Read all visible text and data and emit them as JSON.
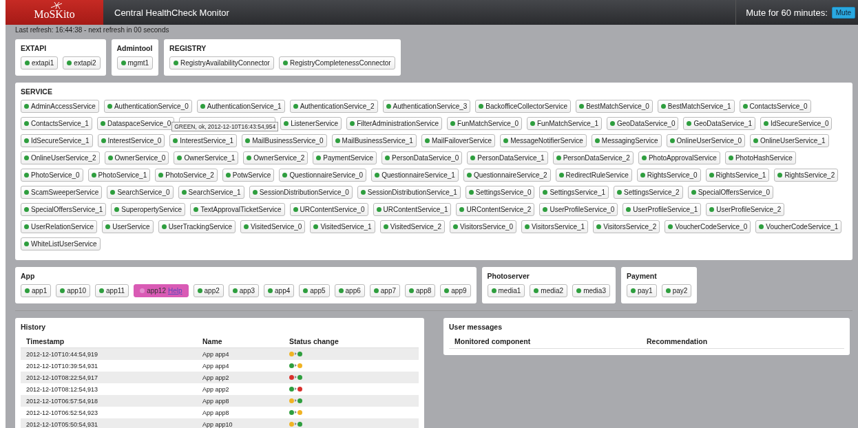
{
  "header": {
    "logo": "MoSKito",
    "title": "Central HealthCheck Monitor",
    "mute_label": "Mute for 60 minutes:",
    "mute_button": "Mute"
  },
  "refresh": "Last refresh: 16:44:38 - next refresh in 00 seconds",
  "top_groups": [
    {
      "title": "EXTAPI",
      "components": [
        {
          "label": "extapi1",
          "color": "#2e9e3e"
        },
        {
          "label": "extapi2",
          "color": "#2e9e3e"
        }
      ]
    },
    {
      "title": "Admintool",
      "components": [
        {
          "label": "mgmt1",
          "color": "#2e9e3e"
        }
      ]
    },
    {
      "title": "REGISTRY",
      "components": [
        {
          "label": "RegistryAvailabilityConnector",
          "color": "#2e9e3e"
        },
        {
          "label": "RegistryCompletenessConnector",
          "color": "#2e9e3e"
        }
      ]
    }
  ],
  "service": {
    "title": "SERVICE",
    "tooltip": "GREEN, ok, 2012-12-10T16:43:54,954",
    "components": [
      {
        "label": "AdminAccessService",
        "color": "#2e9e3e"
      },
      {
        "label": "AuthenticationService_0",
        "color": "#2e9e3e"
      },
      {
        "label": "AuthenticationService_1",
        "color": "#2e9e3e"
      },
      {
        "label": "AuthenticationService_2",
        "color": "#2e9e3e"
      },
      {
        "label": "AuthenticationService_3",
        "color": "#2e9e3e"
      },
      {
        "label": "BackofficeCollectorService",
        "color": "#2e9e3e"
      },
      {
        "label": "BestMatchService_0",
        "color": "#2e9e3e"
      },
      {
        "label": "BestMatchService_1",
        "color": "#2e9e3e"
      },
      {
        "label": "ContactsService_0",
        "color": "#2e9e3e"
      },
      {
        "label": "ContactsService_1",
        "color": "#2e9e3e"
      },
      {
        "label": "DataspaceService_0",
        "color": "#2e9e3e"
      },
      {
        "kind": "covered"
      },
      {
        "label": "ListenerService",
        "color": "#2e9e3e"
      },
      {
        "label": "FilterAdministrationService",
        "color": "#2e9e3e"
      },
      {
        "label": "FunMatchService_0",
        "color": "#2e9e3e"
      },
      {
        "label": "FunMatchService_1",
        "color": "#2e9e3e"
      },
      {
        "label": "GeoDataService_0",
        "color": "#2e9e3e"
      },
      {
        "label": "GeoDataService_1",
        "color": "#2e9e3e"
      },
      {
        "label": "IdSecureService_0",
        "color": "#2e9e3e"
      },
      {
        "label": "IdSecureService_1",
        "color": "#2e9e3e"
      },
      {
        "label": "InterestService_0",
        "color": "#2e9e3e"
      },
      {
        "label": "InterestService_1",
        "color": "#2e9e3e"
      },
      {
        "label": "MailBusinessService_0",
        "color": "#2e9e3e"
      },
      {
        "label": "MailBusinessService_1",
        "color": "#2e9e3e"
      },
      {
        "label": "MailFailoverService",
        "color": "#2e9e3e"
      },
      {
        "label": "MessageNotifierService",
        "color": "#2e9e3e"
      },
      {
        "label": "MessagingService",
        "color": "#2e9e3e"
      },
      {
        "label": "OnlineUserService_0",
        "color": "#2e9e3e"
      },
      {
        "label": "OnlineUserService_1",
        "color": "#2e9e3e"
      },
      {
        "label": "OnlineUserService_2",
        "color": "#2e9e3e"
      },
      {
        "label": "OwnerService_0",
        "color": "#2e9e3e"
      },
      {
        "label": "OwnerService_1",
        "color": "#2e9e3e"
      },
      {
        "label": "OwnerService_2",
        "color": "#2e9e3e"
      },
      {
        "label": "PaymentService",
        "color": "#2e9e3e"
      },
      {
        "label": "PersonDataService_0",
        "color": "#2e9e3e"
      },
      {
        "label": "PersonDataService_1",
        "color": "#2e9e3e"
      },
      {
        "label": "PersonDataService_2",
        "color": "#2e9e3e"
      },
      {
        "label": "PhotoApprovalService",
        "color": "#2e9e3e"
      },
      {
        "label": "PhotoHashService",
        "color": "#2e9e3e"
      },
      {
        "label": "PhotoService_0",
        "color": "#2e9e3e"
      },
      {
        "label": "PhotoService_1",
        "color": "#2e9e3e"
      },
      {
        "label": "PhotoService_2",
        "color": "#2e9e3e"
      },
      {
        "label": "PotwService",
        "color": "#2e9e3e"
      },
      {
        "label": "QuestionnaireService_0",
        "color": "#2e9e3e"
      },
      {
        "label": "QuestionnaireService_1",
        "color": "#2e9e3e"
      },
      {
        "label": "QuestionnaireService_2",
        "color": "#2e9e3e"
      },
      {
        "label": "RedirectRuleService",
        "color": "#2e9e3e"
      },
      {
        "label": "RightsService_0",
        "color": "#2e9e3e"
      },
      {
        "label": "RightsService_1",
        "color": "#2e9e3e"
      },
      {
        "label": "RightsService_2",
        "color": "#2e9e3e"
      },
      {
        "label": "ScamSweeperService",
        "color": "#2e9e3e"
      },
      {
        "label": "SearchService_0",
        "color": "#2e9e3e"
      },
      {
        "label": "SearchService_1",
        "color": "#2e9e3e"
      },
      {
        "label": "SessionDistributionService_0",
        "color": "#2e9e3e"
      },
      {
        "label": "SessionDistributionService_1",
        "color": "#2e9e3e"
      },
      {
        "label": "SettingsService_0",
        "color": "#2e9e3e"
      },
      {
        "label": "SettingsService_1",
        "color": "#2e9e3e"
      },
      {
        "label": "SettingsService_2",
        "color": "#2e9e3e"
      },
      {
        "label": "SpecialOffersService_0",
        "color": "#2e9e3e"
      },
      {
        "label": "SpecialOffersService_1",
        "color": "#2e9e3e"
      },
      {
        "label": "SuperopertyService",
        "color": "#2e9e3e"
      },
      {
        "label": "TextApprovalTicketService",
        "color": "#2e9e3e"
      },
      {
        "label": "URContentService_0",
        "color": "#2e9e3e"
      },
      {
        "label": "URContentService_1",
        "color": "#2e9e3e"
      },
      {
        "label": "URContentService_2",
        "color": "#2e9e3e"
      },
      {
        "label": "UserProfileService_0",
        "color": "#2e9e3e"
      },
      {
        "label": "UserProfileService_1",
        "color": "#2e9e3e"
      },
      {
        "label": "UserProfileService_2",
        "color": "#2e9e3e"
      },
      {
        "label": "UserRelationService",
        "color": "#2e9e3e"
      },
      {
        "label": "UserService",
        "color": "#2e9e3e"
      },
      {
        "label": "UserTrackingService",
        "color": "#2e9e3e"
      },
      {
        "label": "VisitedService_0",
        "color": "#2e9e3e"
      },
      {
        "label": "VisitedService_1",
        "color": "#2e9e3e"
      },
      {
        "label": "VisitedService_2",
        "color": "#2e9e3e"
      },
      {
        "label": "VisitorsService_0",
        "color": "#2e9e3e"
      },
      {
        "label": "VisitorsService_1",
        "color": "#2e9e3e"
      },
      {
        "label": "VisitorsService_2",
        "color": "#2e9e3e"
      },
      {
        "label": "VoucherCodeService_0",
        "color": "#2e9e3e"
      },
      {
        "label": "VoucherCodeService_1",
        "color": "#2e9e3e"
      },
      {
        "label": "WhiteListUserService",
        "color": "#2e9e3e"
      }
    ]
  },
  "bottom_groups": [
    {
      "title": "App",
      "components": [
        {
          "label": "app1",
          "color": "#2e9e3e"
        },
        {
          "label": "app10",
          "color": "#2e9e3e"
        },
        {
          "label": "app11",
          "color": "#2e9e3e"
        },
        {
          "label": "app12",
          "color": "#e38fcf",
          "kind": "alert",
          "help": "Help"
        },
        {
          "label": "app2",
          "color": "#2e9e3e"
        },
        {
          "label": "app3",
          "color": "#2e9e3e"
        },
        {
          "label": "app4",
          "color": "#2e9e3e"
        },
        {
          "label": "app5",
          "color": "#2e9e3e"
        },
        {
          "label": "app6",
          "color": "#2e9e3e"
        },
        {
          "label": "app7",
          "color": "#2e9e3e"
        },
        {
          "label": "app8",
          "color": "#2e9e3e"
        },
        {
          "label": "app9",
          "color": "#2e9e3e"
        }
      ]
    },
    {
      "title": "Photoserver",
      "components": [
        {
          "label": "media1",
          "color": "#2e9e3e"
        },
        {
          "label": "media2",
          "color": "#2e9e3e"
        },
        {
          "label": "media3",
          "color": "#2e9e3e"
        }
      ]
    },
    {
      "title": "Payment",
      "components": [
        {
          "label": "pay1",
          "color": "#2e9e3e"
        },
        {
          "label": "pay2",
          "color": "#2e9e3e"
        }
      ]
    }
  ],
  "history": {
    "title": "History",
    "columns": [
      "Timestamp",
      "Name",
      "Status change"
    ],
    "rows": [
      {
        "timestamp": "2012-12-10T10:44:54,919",
        "name": "App app4",
        "status_change": [
          {
            "color": "#f0b323"
          },
          {
            "color": "#2e9e3e"
          }
        ]
      },
      {
        "timestamp": "2012-12-10T10:39:54,931",
        "name": "App app4",
        "status_change": [
          {
            "color": "#2e9e3e"
          },
          {
            "color": "#f0b323"
          }
        ]
      },
      {
        "timestamp": "2012-12-10T08:22:54,917",
        "name": "App app2",
        "status_change": [
          {
            "color": "#d9302c"
          },
          {
            "color": "#2e9e3e"
          }
        ]
      },
      {
        "timestamp": "2012-12-10T08:12:54,913",
        "name": "App app2",
        "status_change": [
          {
            "color": "#2e9e3e"
          },
          {
            "color": "#d9302c"
          }
        ]
      },
      {
        "timestamp": "2012-12-10T06:57:54,918",
        "name": "App app8",
        "status_change": [
          {
            "color": "#f0b323"
          },
          {
            "color": "#2e9e3e"
          }
        ]
      },
      {
        "timestamp": "2012-12-10T06:52:54,923",
        "name": "App app8",
        "status_change": [
          {
            "color": "#2e9e3e"
          },
          {
            "color": "#f0b323"
          }
        ]
      },
      {
        "timestamp": "2012-12-10T05:50:54,931",
        "name": "App app10",
        "status_change": [
          {
            "color": "#f0b323"
          },
          {
            "color": "#2e9e3e"
          }
        ]
      }
    ]
  },
  "user_messages": {
    "title": "User messages",
    "columns": [
      "Monitored component",
      "Recommendation"
    ]
  }
}
